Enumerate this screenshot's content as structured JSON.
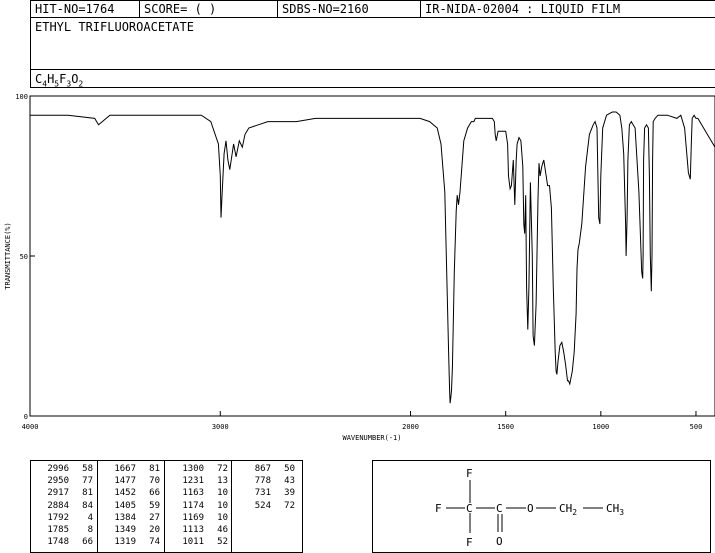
{
  "header": {
    "hit_no": "HIT-NO=1764",
    "score": "SCORE=  (   )",
    "sdbs_no": "SDBS-NO=2160",
    "ir_code": "IR-NIDA-02004 : LIQUID FILM"
  },
  "compound_name": "ETHYL TRIFLUOROACETATE",
  "formula": {
    "c": "C",
    "c_n": "4",
    "h": "H",
    "h_n": "5",
    "f": "F",
    "f_n": "3",
    "o": "O",
    "o_n": "2"
  },
  "chart_data": {
    "type": "line",
    "xlabel": "WAVENUMBER(-1)",
    "ylabel": "TRANSMITTANCE(%)",
    "xlim": [
      4000,
      400
    ],
    "ylim": [
      0,
      100
    ],
    "x_ticks": [
      4000,
      3000,
      2000,
      1500,
      1000,
      500
    ],
    "y_ticks": [
      0,
      50,
      100
    ],
    "grid": false,
    "series": [
      {
        "x": [
          4000,
          3800,
          3660,
          3640,
          3620,
          3580,
          3400,
          3100,
          3050,
          3010,
          3000,
          2996,
          2990,
          2980,
          2970,
          2960,
          2950,
          2940,
          2930,
          2917,
          2900,
          2884,
          2870,
          2850,
          2800,
          2750,
          2700,
          2600,
          2500,
          2400,
          2300,
          2200,
          2100,
          2000,
          1950,
          1900,
          1860,
          1840,
          1820,
          1810,
          1800,
          1795,
          1792,
          1788,
          1785,
          1780,
          1770,
          1760,
          1755,
          1750,
          1748,
          1740,
          1720,
          1700,
          1680,
          1667,
          1660,
          1650,
          1600,
          1570,
          1560,
          1555,
          1550,
          1540,
          1500,
          1490,
          1485,
          1477,
          1470,
          1460,
          1452,
          1445,
          1440,
          1430,
          1420,
          1410,
          1405,
          1400,
          1395,
          1390,
          1384,
          1378,
          1370,
          1360,
          1356,
          1349,
          1340,
          1330,
          1325,
          1319,
          1310,
          1300,
          1290,
          1280,
          1270,
          1260,
          1250,
          1240,
          1235,
          1231,
          1225,
          1215,
          1205,
          1195,
          1185,
          1175,
          1170,
          1163,
          1160,
          1150,
          1140,
          1130,
          1125,
          1120,
          1113,
          1100,
          1080,
          1060,
          1040,
          1030,
          1020,
          1011,
          1005,
          1000,
          990,
          970,
          940,
          920,
          900,
          890,
          880,
          870,
          867,
          862,
          858,
          850,
          840,
          820,
          800,
          785,
          780,
          778,
          775,
          770,
          760,
          750,
          745,
          740,
          735,
          731,
          728,
          725,
          715,
          700,
          650,
          600,
          580,
          560,
          540,
          530,
          524,
          520,
          510,
          500,
          490,
          470,
          450,
          430,
          410,
          400
        ],
        "y": [
          94,
          94,
          93,
          91,
          92,
          94,
          94,
          94,
          92,
          85,
          75,
          62,
          70,
          82,
          86,
          80,
          77,
          81,
          85,
          81,
          86,
          84,
          88,
          90,
          91,
          92,
          92,
          92,
          93,
          93,
          93,
          93,
          93,
          93,
          93,
          92,
          90,
          85,
          70,
          45,
          20,
          8,
          4,
          6,
          8,
          15,
          45,
          64,
          69,
          67,
          66,
          70,
          86,
          90,
          92,
          92,
          93,
          93,
          93,
          93,
          92,
          88,
          86,
          89,
          89,
          85,
          75,
          71,
          72,
          80,
          66,
          80,
          85,
          87,
          86,
          78,
          60,
          57,
          69,
          40,
          27,
          40,
          73,
          50,
          25,
          22,
          35,
          68,
          79,
          75,
          78,
          80,
          76,
          72,
          72,
          65,
          40,
          20,
          14,
          13,
          17,
          22,
          23,
          20,
          16,
          11,
          11,
          10,
          11,
          14,
          20,
          32,
          46,
          52,
          54,
          60,
          78,
          88,
          91,
          92,
          90,
          62,
          60,
          75,
          90,
          94,
          95,
          95,
          94,
          90,
          82,
          60,
          50,
          62,
          80,
          91,
          92,
          90,
          70,
          45,
          43,
          50,
          80,
          90,
          91,
          90,
          75,
          50,
          39,
          50,
          80,
          92,
          93,
          94,
          94,
          93,
          94,
          90,
          76,
          74,
          86,
          93,
          94,
          93,
          93,
          91,
          89,
          87,
          85,
          84
        ]
      }
    ]
  },
  "peaks_columns": [
    [
      [
        "2996",
        "58"
      ],
      [
        "2950",
        "77"
      ],
      [
        "2917",
        "81"
      ],
      [
        "2884",
        "84"
      ],
      [
        "1792",
        "4"
      ],
      [
        "1785",
        "8"
      ],
      [
        "1748",
        "66"
      ]
    ],
    [
      [
        "1667",
        "81"
      ],
      [
        "1477",
        "70"
      ],
      [
        "1452",
        "66"
      ],
      [
        "1405",
        "59"
      ],
      [
        "1384",
        "27"
      ],
      [
        "1349",
        "20"
      ],
      [
        "1319",
        "74"
      ]
    ],
    [
      [
        "1300",
        "72"
      ],
      [
        "1231",
        "13"
      ],
      [
        "1163",
        "10"
      ],
      [
        "1174",
        "10"
      ],
      [
        "1169",
        "10"
      ],
      [
        "1113",
        "46"
      ],
      [
        "1011",
        "52"
      ]
    ],
    [
      [
        "867",
        "50"
      ],
      [
        "778",
        "43"
      ],
      [
        "731",
        "39"
      ],
      [
        "524",
        "72"
      ]
    ]
  ],
  "structure": {
    "f_top": "F",
    "f_left": "F",
    "f_bottom": "F",
    "c1": "C",
    "c2": "C",
    "o_ester": "O",
    "o_carbonyl": "O",
    "ch2_label": "CH",
    "ch2_sub": "2",
    "ch3_label": "CH",
    "ch3_sub": "3"
  }
}
